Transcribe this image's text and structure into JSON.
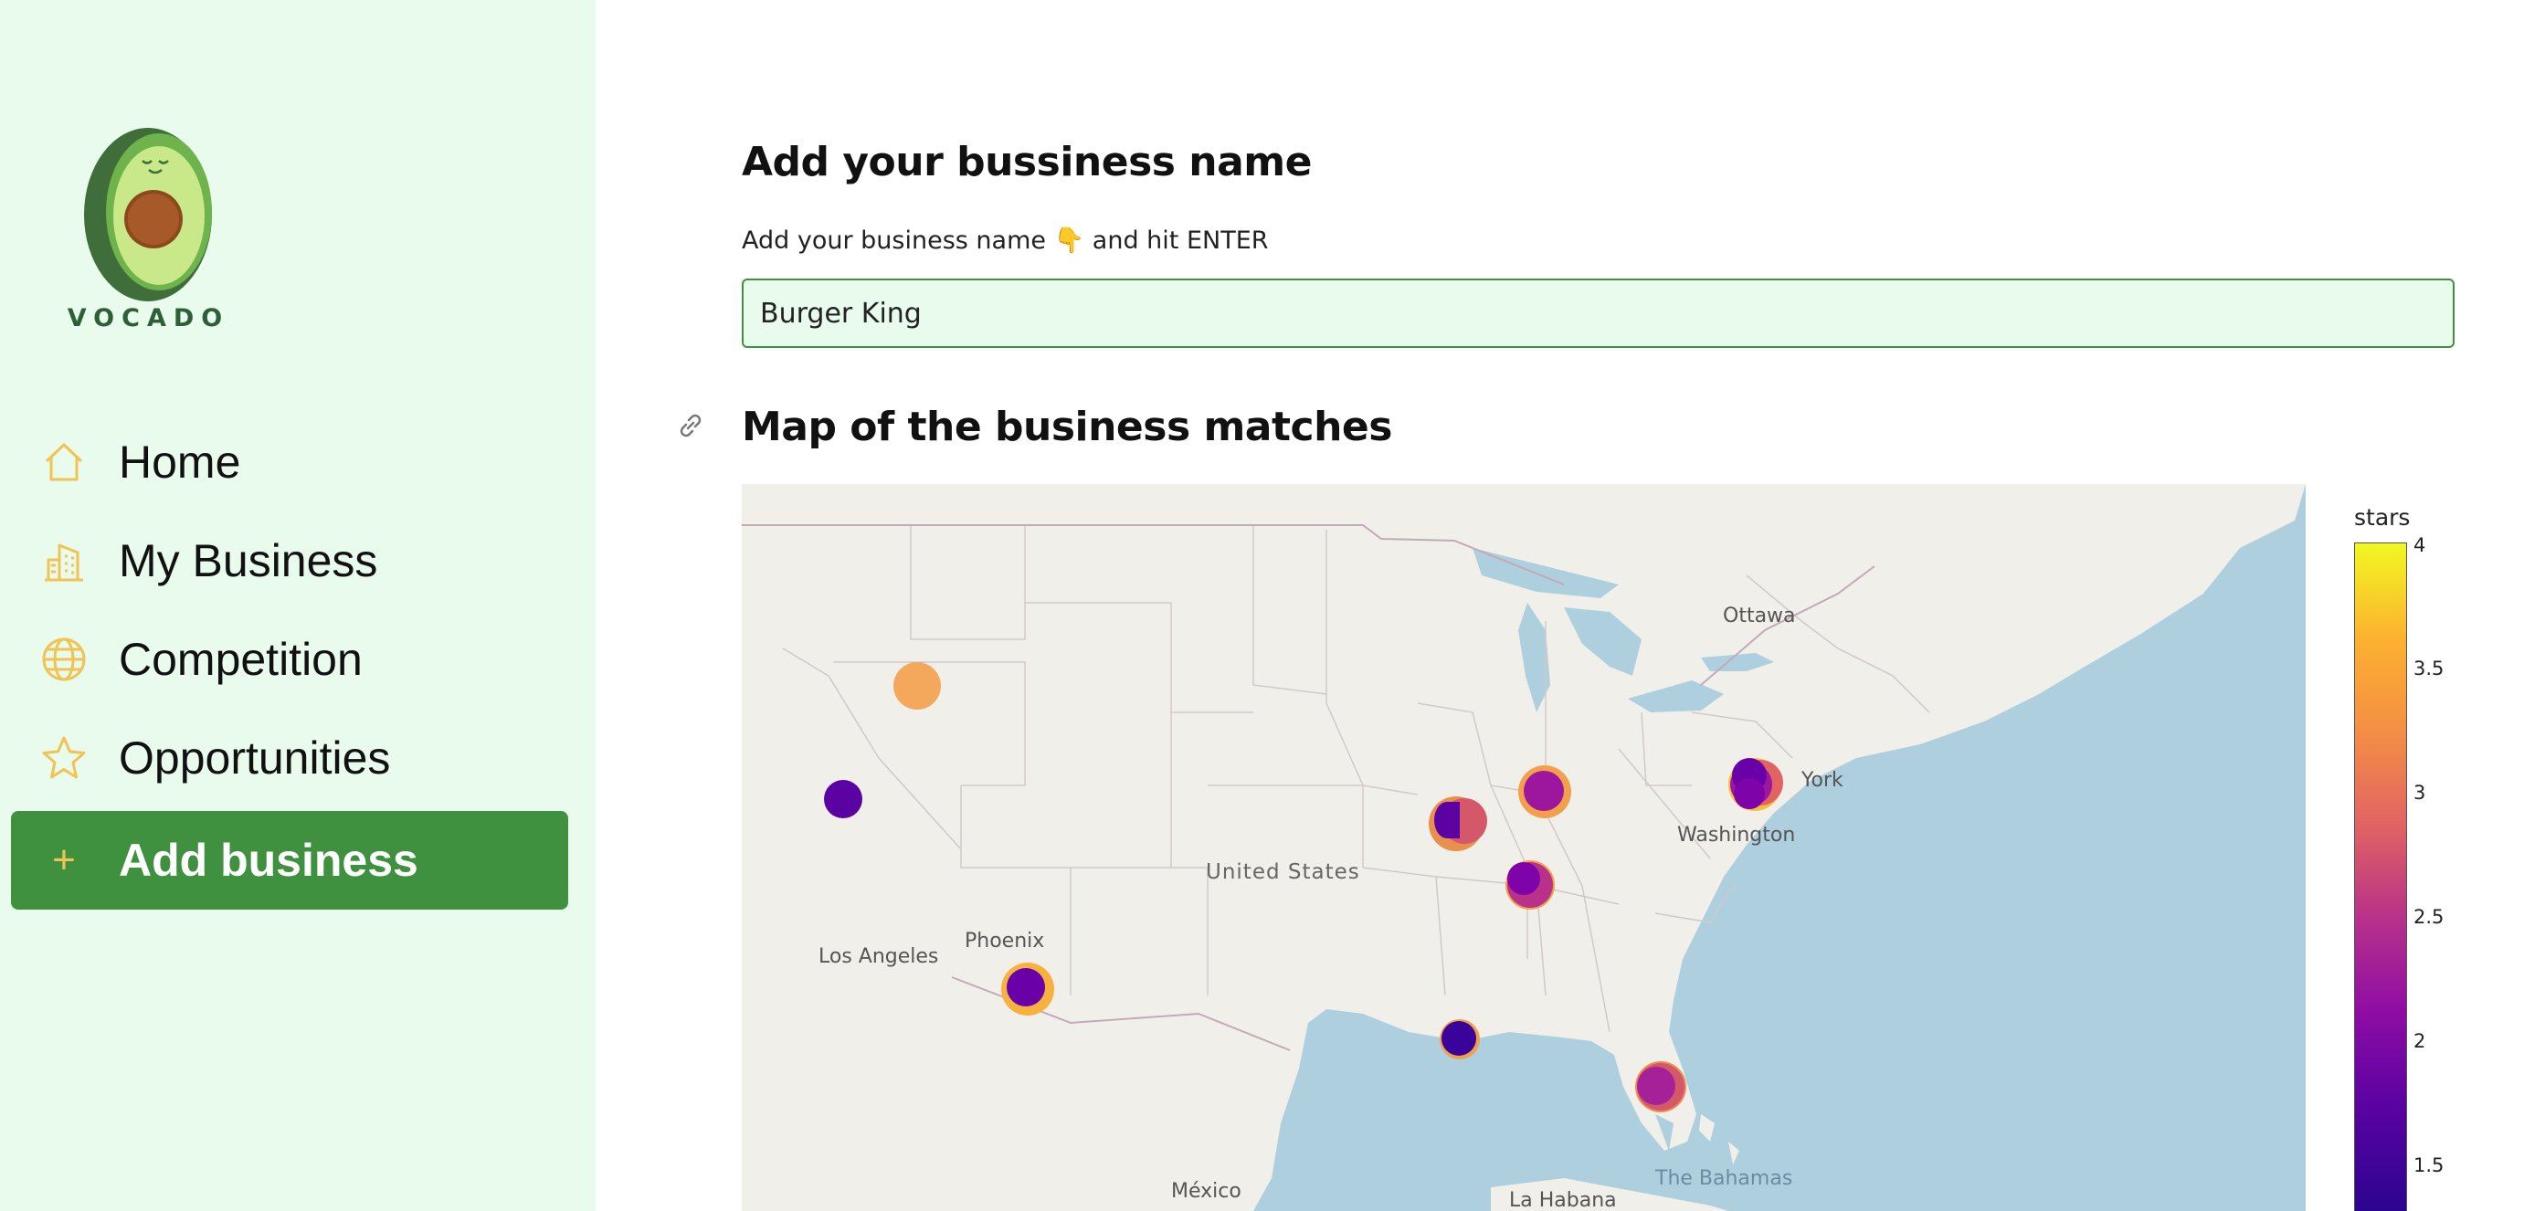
{
  "sidebar": {
    "brand": "VOCADO",
    "items": [
      {
        "label": "Home",
        "icon": "home-icon"
      },
      {
        "label": "My Business",
        "icon": "building-icon"
      },
      {
        "label": "Competition",
        "icon": "globe-icon"
      },
      {
        "label": "Opportunities",
        "icon": "star-icon"
      },
      {
        "label": "Add business",
        "icon": "plus-icon",
        "active": true
      }
    ]
  },
  "main": {
    "heading": "Add your bussiness name",
    "input_label_start": "Add your business name",
    "input_label_emoji": "👇",
    "input_label_end": "and hit ENTER",
    "input_value": "Burger King",
    "map_heading": "Map of the business matches"
  },
  "map": {
    "places": {
      "ottawa": "Ottawa",
      "york": "York",
      "washington": "Washington",
      "united_states": "United States",
      "phoenix": "Phoenix",
      "los_angeles": "Los Angeles",
      "mexico": "México",
      "la_habana": "La Habana",
      "bahamas": "The Bahamas"
    },
    "colorbar": {
      "title": "stars",
      "ticks": [
        "4",
        "3.5",
        "3",
        "2.5",
        "2",
        "1.5"
      ]
    }
  },
  "colors": {
    "sidebar_bg": "#e8fbed",
    "accent_green": "#3f9140",
    "icon_gold": "#f0c454"
  }
}
